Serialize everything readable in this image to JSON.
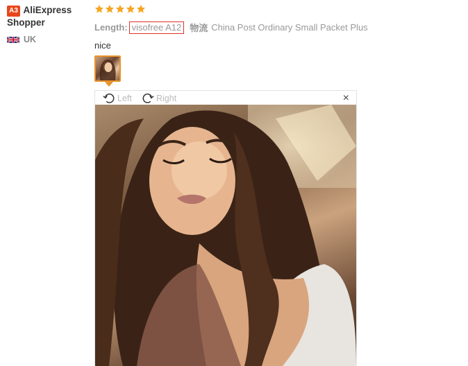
{
  "user": {
    "badge": "A3",
    "name_first": "AliExpress",
    "name_second": "Shopper",
    "country": "UK",
    "flag_icon": "uk-flag-icon"
  },
  "review": {
    "rating": 5,
    "star_color": "#f5a623",
    "length_label": "Length:",
    "length_value": "visofree A12",
    "shipping_label": "物流",
    "shipping_value": "China Post Ordinary Small Packet Plus",
    "comment": "nice"
  },
  "viewer": {
    "rotate_left_label": "Left",
    "rotate_right_label": "Right",
    "close_label": "×",
    "accent_color": "#e8932a"
  }
}
